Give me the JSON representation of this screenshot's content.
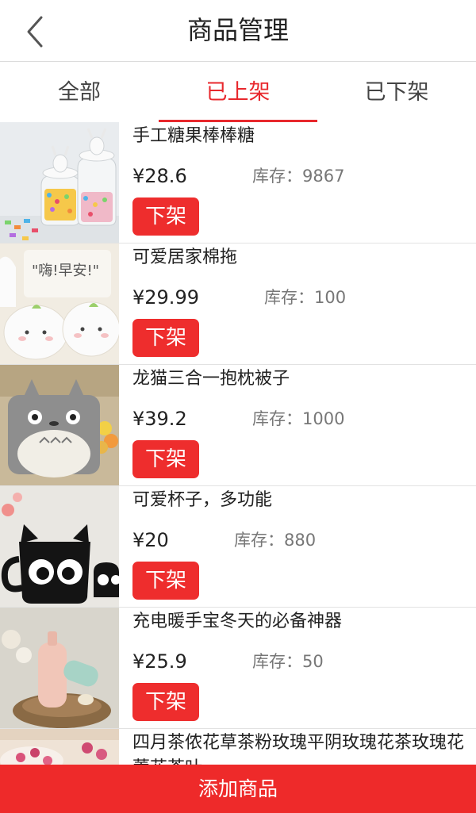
{
  "header": {
    "title": "商品管理"
  },
  "tabs": [
    {
      "label": "全部",
      "active": false
    },
    {
      "label": "已上架",
      "active": true
    },
    {
      "label": "已下架",
      "active": false
    }
  ],
  "products": [
    {
      "name": "手工糖果棒棒糖",
      "price": "¥28.6",
      "stock": "库存：9867",
      "action": "下架",
      "image": "candy-jars"
    },
    {
      "name": "可爱居家棉拖",
      "price": "¥29.99",
      "stock": "库存：100",
      "action": "下架",
      "image": "slippers"
    },
    {
      "name": "龙猫三合一抱枕被子",
      "price": "¥39.2",
      "stock": "库存：1000",
      "action": "下架",
      "image": "totoro-pillow"
    },
    {
      "name": "可爱杯子，多功能",
      "price": "¥20",
      "stock": "库存：880",
      "action": "下架",
      "image": "cat-mug"
    },
    {
      "name": "充电暖手宝冬天的必备神器",
      "price": "¥25.9",
      "stock": "库存：50",
      "action": "下架",
      "image": "hand-warmer"
    },
    {
      "name": "四月茶侬花草茶粉玫瑰平阴玫瑰花茶玫瑰花蕾花茶叶",
      "image": "rose-tea"
    }
  ],
  "bottom_bar": {
    "label": "添加商品"
  },
  "colors": {
    "accent": "#ee2d2d",
    "tab_active": "#e8282d"
  }
}
